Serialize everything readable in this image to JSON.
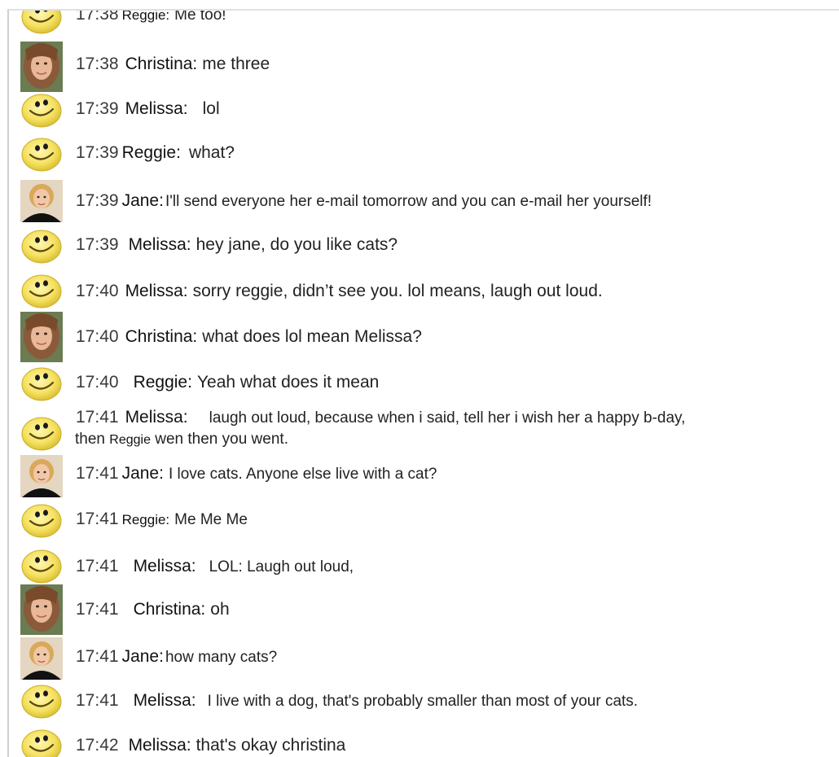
{
  "messages": [
    {
      "time": "17:38",
      "name": "Reggie:",
      "text": "Me too!",
      "avatar": "smiley-icon"
    },
    {
      "time": "17:38",
      "name": "Christina:",
      "text": "me three",
      "avatar": "christina-photo"
    },
    {
      "time": "17:39",
      "name": "Melissa:",
      "text": "lol",
      "avatar": "smiley-icon"
    },
    {
      "time": "17:39",
      "name": "Reggie:",
      "text": "what?",
      "avatar": "smiley-icon"
    },
    {
      "time": "17:39",
      "name": "Jane:",
      "text": "I'll send everyone her e-mail tomorrow and you can e-mail her yourself!",
      "avatar": "jane-photo"
    },
    {
      "time": "17:39",
      "name": "Melissa:",
      "text": "hey jane, do you like cats?",
      "avatar": "smiley-icon"
    },
    {
      "time": "17:40",
      "name": "Melissa:",
      "text": "sorry reggie, didn’t see you. lol means, laugh out loud.",
      "avatar": "smiley-icon"
    },
    {
      "time": "17:40",
      "name": "Christina:",
      "text": "what does lol mean Melissa?",
      "avatar": "christina-photo"
    },
    {
      "time": "17:40",
      "name": "Reggie:",
      "text": "Yeah what does it mean",
      "avatar": "smiley-icon"
    },
    {
      "time": "17:41",
      "name": "Melissa:",
      "text": "laugh out loud, because when i said, tell her i wish her a happy b-day,",
      "line2_pre": "then",
      "line2_name": "Reggie",
      "line2_post": "wen then you went.",
      "avatar": "smiley-icon"
    },
    {
      "time": "17:41",
      "name": "Jane:",
      "text": "I love cats. Anyone else live with a cat?",
      "avatar": "jane-photo"
    },
    {
      "time": "17:41",
      "name": "Reggie:",
      "text": "Me Me Me",
      "avatar": "smiley-icon"
    },
    {
      "time": "17:41",
      "name": "Melissa:",
      "text": "LOL: Laugh out loud,",
      "avatar": "smiley-icon"
    },
    {
      "time": "17:41",
      "name": "Christina:",
      "text": "oh",
      "avatar": "christina-photo"
    },
    {
      "time": "17:41",
      "name": "Jane:",
      "text": "how many cats?",
      "avatar": "jane-photo"
    },
    {
      "time": "17:41",
      "name": "Melissa:",
      "text": "I live with a dog, that's probably smaller than most of your cats.",
      "avatar": "smiley-icon"
    },
    {
      "time": "17:42",
      "name": "Melissa:",
      "text": "that's okay christina",
      "avatar": "smiley-icon"
    }
  ]
}
